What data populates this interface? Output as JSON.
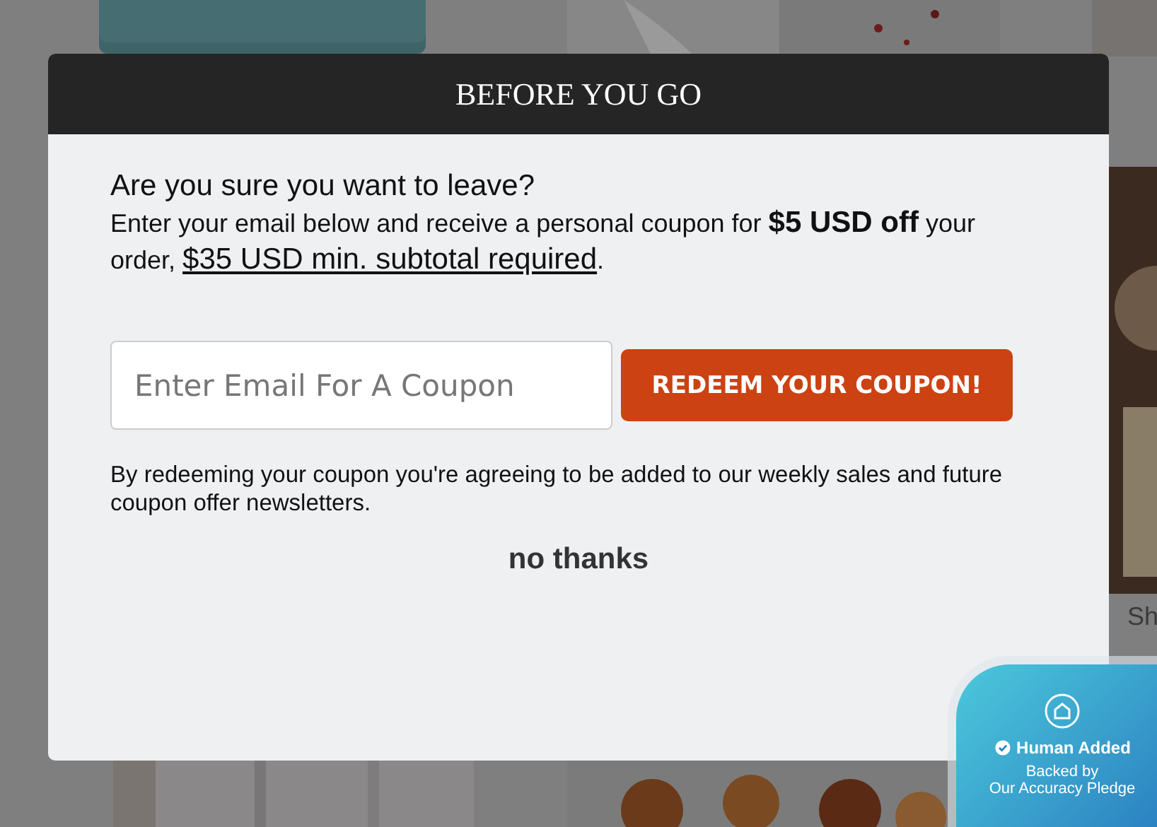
{
  "modal": {
    "title": "BEFORE YOU GO",
    "heading": "Are you sure you want to leave?",
    "offer": "Enter your email below and receive a personal coupon for **$5 USD off** your order,",
    "offer_link": "$35 USD min. subtotal required",
    "offer_end": ".",
    "email_field": {
      "placeholder": "Enter Email For A Coupon"
    },
    "redeem_button": "REDEEM YOUR COUPON!",
    "disclaimer": "By redeeming your coupon you're agreeing to be added to our weekly sales and future coupon offer newsletters.",
    "decline": "no thanks"
  },
  "background": {
    "cut_text": "Sh"
  },
  "badge": {
    "title": "Human Added",
    "lines": [
      "Backed by",
      "Our Accuracy Pledge"
    ]
  }
}
